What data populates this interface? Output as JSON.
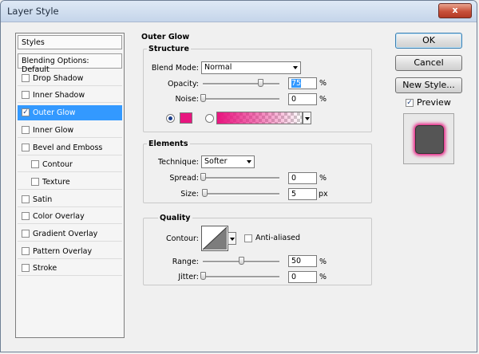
{
  "window": {
    "title": "Layer Style",
    "close_label": "x"
  },
  "styles_list": {
    "header": "Styles",
    "blending_options": "Blending Options: Default",
    "items": [
      {
        "label": "Drop Shadow",
        "checked": false
      },
      {
        "label": "Inner Shadow",
        "checked": false
      },
      {
        "label": "Outer Glow",
        "checked": true,
        "selected": true
      },
      {
        "label": "Inner Glow",
        "checked": false
      },
      {
        "label": "Bevel and Emboss",
        "checked": false
      },
      {
        "label": "Contour",
        "checked": false,
        "indent": true
      },
      {
        "label": "Texture",
        "checked": false,
        "indent": true
      },
      {
        "label": "Satin",
        "checked": false
      },
      {
        "label": "Color Overlay",
        "checked": false
      },
      {
        "label": "Gradient Overlay",
        "checked": false
      },
      {
        "label": "Pattern Overlay",
        "checked": false
      },
      {
        "label": "Stroke",
        "checked": false
      }
    ]
  },
  "outer_glow": {
    "title": "Outer Glow",
    "structure": {
      "title": "Structure",
      "blend_mode_label": "Blend Mode:",
      "blend_mode_value": "Normal",
      "opacity_label": "Opacity:",
      "opacity_value": "75",
      "opacity_unit": "%",
      "opacity_fraction": 0.75,
      "noise_label": "Noise:",
      "noise_value": "0",
      "noise_unit": "%",
      "noise_fraction": 0.0,
      "color_mode": "solid",
      "glow_color": "#e8157f"
    },
    "elements": {
      "title": "Elements",
      "technique_label": "Technique:",
      "technique_value": "Softer",
      "spread_label": "Spread:",
      "spread_value": "0",
      "spread_unit": "%",
      "spread_fraction": 0.0,
      "size_label": "Size:",
      "size_value": "5",
      "size_unit": "px",
      "size_fraction": 0.02
    },
    "quality": {
      "title": "Quality",
      "contour_label": "Contour:",
      "anti_aliased_label": "Anti-aliased",
      "anti_aliased_checked": false,
      "range_label": "Range:",
      "range_value": "50",
      "range_unit": "%",
      "range_fraction": 0.5,
      "jitter_label": "Jitter:",
      "jitter_value": "0",
      "jitter_unit": "%",
      "jitter_fraction": 0.0
    }
  },
  "buttons": {
    "ok": "OK",
    "cancel": "Cancel",
    "new_style": "New Style...",
    "preview_label": "Preview",
    "preview_checked": true
  }
}
